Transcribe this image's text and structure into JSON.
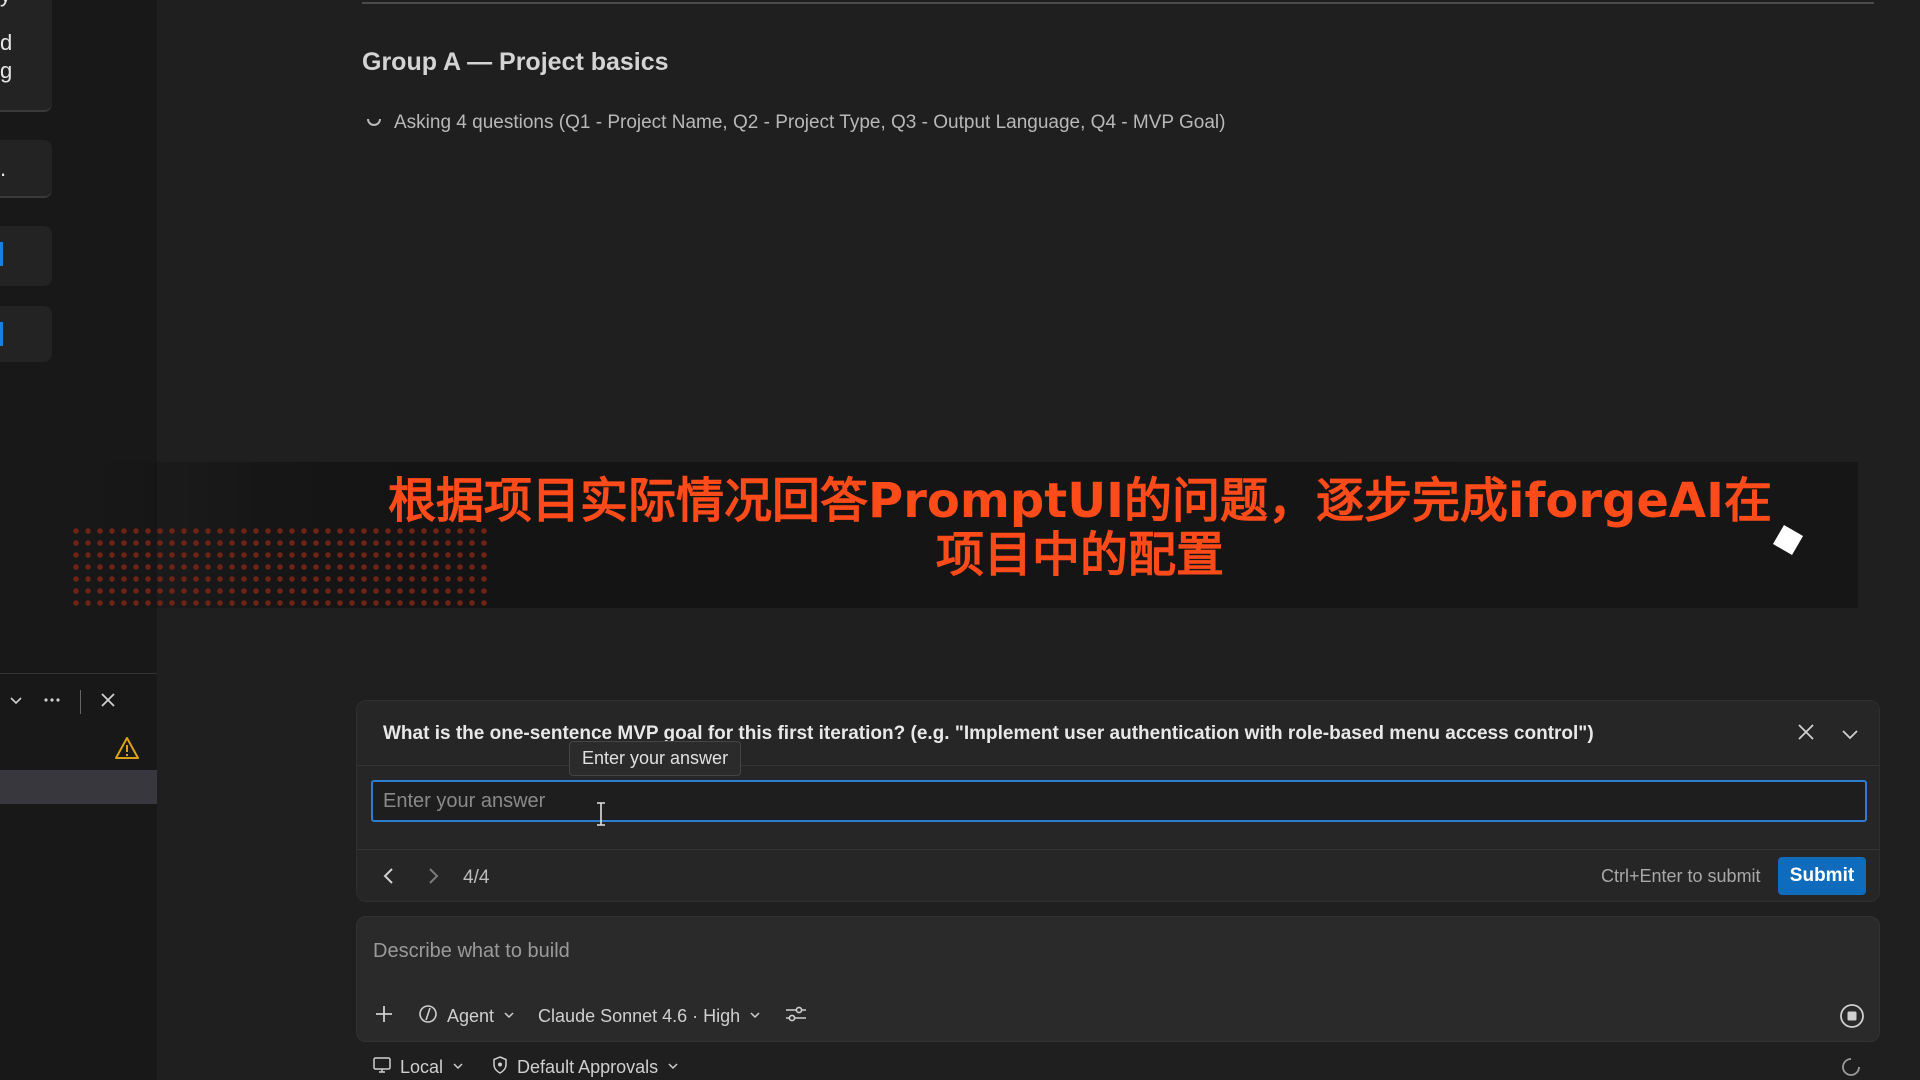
{
  "sidebar": {
    "card1_lines": [
      "y",
      "d",
      "g"
    ],
    "card2_line": "."
  },
  "main": {
    "group_title": "Group A — Project basics",
    "status_text": "Asking 4 questions (Q1 - Project Name, Q2 - Project Type, Q3 - Output Language, Q4 - MVP Goal)"
  },
  "overlay": {
    "caption": "根据项目实际情况回答PromptUI的问题，逐步完成iforgeAI在项目中的配置",
    "color": "#ff4a1a"
  },
  "question": {
    "text": "What is the one-sentence MVP goal for this first iteration? (e.g. \"Implement user authentication with role-based menu access control\")",
    "tooltip": "Enter your answer",
    "placeholder": "Enter your answer",
    "value": "",
    "page": "4/4",
    "submit_hint": "Ctrl+Enter to submit",
    "submit_label": "Submit",
    "accent_color": "#0f6cbd"
  },
  "composer": {
    "placeholder": "Describe what to build",
    "mode_label": "Agent",
    "model_label": "Claude Sonnet 4.6 · High"
  },
  "footer": {
    "location_label": "Local",
    "approvals_label": "Default Approvals"
  }
}
